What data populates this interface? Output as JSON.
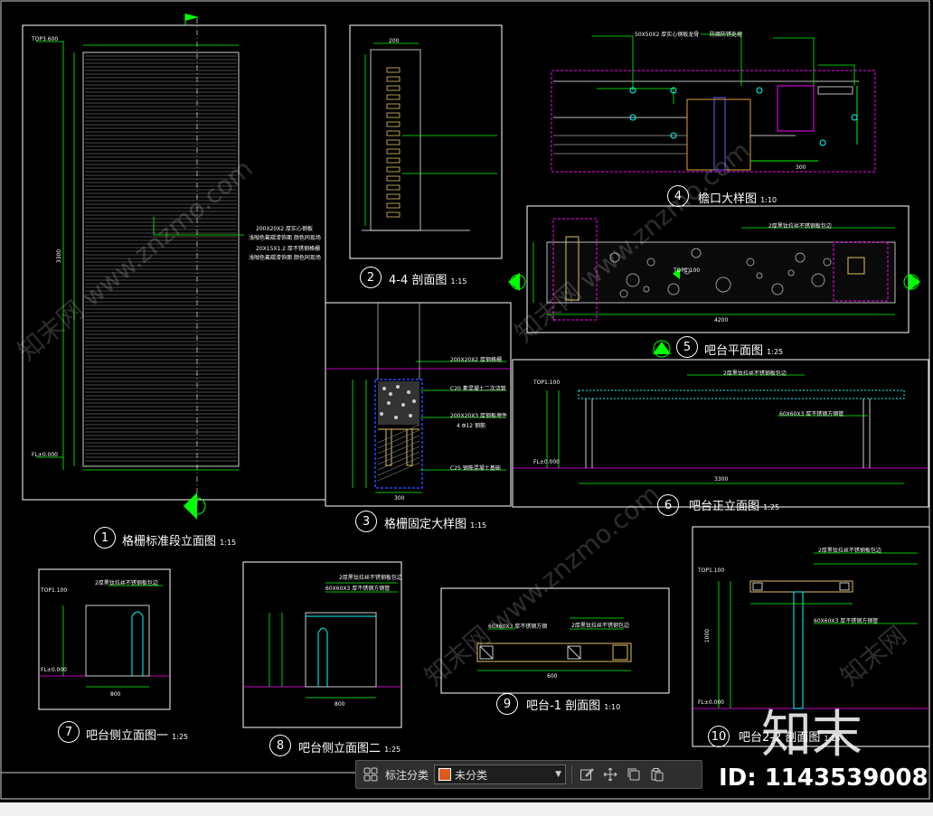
{
  "drawing": {
    "views": [
      {
        "num": "1",
        "title": "格栅标准段立面图",
        "scale": "1:15"
      },
      {
        "num": "2",
        "title": "4-4  剖面图",
        "scale": "1:15"
      },
      {
        "num": "3",
        "title": "格栅固定大样图",
        "scale": "1:15"
      },
      {
        "num": "4",
        "title": "檐口大样图",
        "scale": "1:10"
      },
      {
        "num": "5",
        "title": "吧台平面图",
        "scale": "1:25"
      },
      {
        "num": "6",
        "title": "吧台正立面图",
        "scale": "1:25"
      },
      {
        "num": "7",
        "title": "吧台侧立面图一",
        "scale": "1:25"
      },
      {
        "num": "8",
        "title": "吧台侧立面图二",
        "scale": "1:25"
      },
      {
        "num": "9",
        "title": "吧台-1  剖面图",
        "scale": "1:10"
      },
      {
        "num": "10",
        "title": "吧台2-2  剖面图",
        "scale": "1:15"
      }
    ],
    "annotations": {
      "v1_top": "TOP3.600",
      "v1_bottom": "FL±0.000",
      "v1_height": "3300",
      "v1_note1": "200X20X2    厚实心钢板",
      "v1_note2": "浅咖色氟碳漆饰面 颜色同现场",
      "v1_note3": "20X15X1.2    厚不锈钢格栅",
      "v1_note4": "浅咖色氟碳漆饰面 颜色同现场",
      "v2_w": "200",
      "v3_note1": "200X20X2    厚钢格栅",
      "v3_note2": "C20  素混凝土二次浇筑",
      "v3_note3": "200X20X3    厚钢板埋件",
      "v3_note4": "4  Φ12  钢筋",
      "v3_note5": "C25  钢筋混凝土基础",
      "v3_w": "300",
      "v4_note1": "50X50X2    厚实心钢板龙骨",
      "v4_note2": "防腐防锈处理",
      "v4_dim": "300",
      "v5_note": "2厚黑钛拉丝不锈钢板包边",
      "v5_level": "TOP1.100",
      "v5_length": "4200",
      "v6_top": "TOP1.100",
      "v6_floor": "FL±0.000",
      "v6_note1": "2厚黑钛拉丝不锈钢板包边",
      "v6_note2": "60X60X3    厚不锈钢方钢管",
      "v6_dim": "3300",
      "v7_top": "TOP1.100",
      "v7_floor": "FL±0.000",
      "v7_note": "2厚黑钛拉丝不锈钢板包边",
      "v7_dim": "800",
      "v8_note1": "2厚黑钛拉丝不锈钢板包边",
      "v8_note2": "60X60X3    厚不锈钢方钢管",
      "v8_dim": "800",
      "v9_note1": "60X60X3    厚不锈钢方钢",
      "v9_note2": "2厚黑钛拉丝不锈钢包边",
      "v9_dim": "600",
      "v10_top": "TOP1.100",
      "v10_floor": "FL±0.000",
      "v10_note1": "2厚黑钛拉丝不锈钢板包边",
      "v10_note2": "60X60X3    厚不锈钢方钢管",
      "v10_dim": "1000"
    }
  },
  "toolbar": {
    "label": "标注分类",
    "category": "未分类",
    "category_color": "#e05a1c",
    "icons": [
      "grid-icon",
      "edit-icon",
      "move-icon",
      "copy-icon",
      "paste-icon"
    ]
  },
  "watermark": {
    "logo": "知末",
    "id_text": "ID: 1143539008"
  }
}
